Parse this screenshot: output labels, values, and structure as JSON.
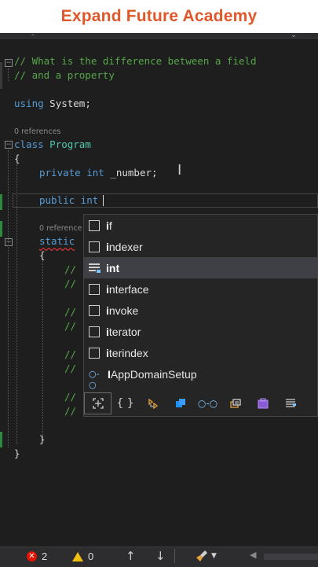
{
  "banner": {
    "title": "Expand Future Academy"
  },
  "code": {
    "comment_line_1": "// What is the difference between a field",
    "comment_line_2": "// and a property",
    "using_kw": "using",
    "using_ns": " System;",
    "refs_class": "0 references",
    "class_kw": "class",
    "class_name": " Program",
    "brace_open": "{",
    "field_private": "private",
    "field_int": " int",
    "field_name": " _number;",
    "edit_public": "public",
    "edit_int": " int",
    "refs_method": "0 reference",
    "static_kw": "static",
    "partial_comments": [
      "//",
      "//",
      "//",
      "//",
      "//",
      "//",
      "//",
      "//"
    ],
    "method_brace_open": "{",
    "method_brace_close": "}",
    "class_brace_close": "}"
  },
  "completion": {
    "items": [
      {
        "match": "i",
        "rest": "f",
        "icon": "keyword-icon"
      },
      {
        "match": "i",
        "rest": "ndexer",
        "icon": "snippet-icon"
      },
      {
        "match": "int",
        "rest": "",
        "icon": "struct-icon"
      },
      {
        "match": "i",
        "rest": "nterface",
        "icon": "snippet-icon"
      },
      {
        "match": "i",
        "rest": "nvoke",
        "icon": "snippet-icon"
      },
      {
        "match": "i",
        "rest": "terator",
        "icon": "snippet-icon"
      },
      {
        "match": "i",
        "rest": "terindex",
        "icon": "snippet-icon"
      },
      {
        "match": "I",
        "rest": "AppDomainSetup",
        "icon": "interface-icon"
      }
    ],
    "selected_index": 2,
    "filter_icons": [
      "snippets-filter-icon",
      "namespaces-filter-icon",
      "classes-filter-icon",
      "structs-filter-icon",
      "interfaces-filter-icon",
      "events-filter-icon",
      "delegates-filter-icon",
      "enums-filter-icon"
    ]
  },
  "statusbar": {
    "errors": "2",
    "warnings": "0"
  }
}
